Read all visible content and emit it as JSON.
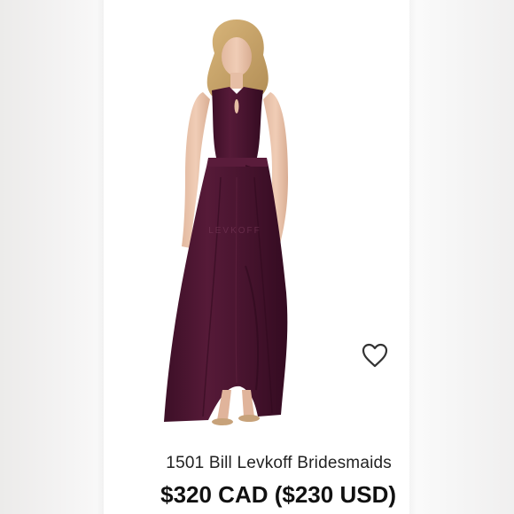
{
  "product": {
    "title": "1501 Bill Levkoff Bridesmaids",
    "price": "$320 CAD ($230 USD)",
    "dress_color": "#4a1530",
    "favorite_icon": "heart-outline-icon"
  },
  "image": {
    "watermark": "LEVKOFF"
  }
}
